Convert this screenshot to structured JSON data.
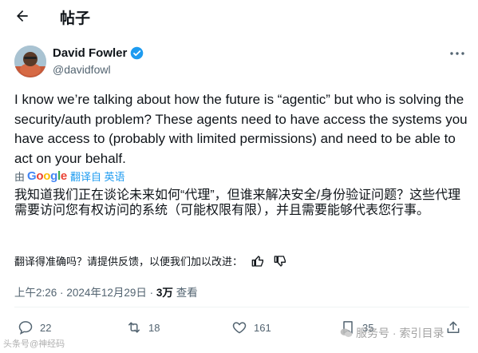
{
  "header": {
    "title": "帖子",
    "back_icon": "arrow-left-icon"
  },
  "author": {
    "name": "David Fowler",
    "handle": "@davidfowl",
    "verified": true
  },
  "tweet": {
    "text": "I know we’re talking about how the future is “agentic” but who is solving the security/auth problem? These agents need to have access the systems you have access to (probably with limited permissions) and need to be able to act on your behalf."
  },
  "translation": {
    "by_prefix": "由",
    "provider": "Google",
    "label": "翻译自 英语",
    "text": "我知道我们正在谈论未来如何“代理”，但谁来解决安全/身份验证问题？这些代理需要访问您有权访问的系统（可能权限有限），并且需要能够代表您行事。",
    "feedback_prompt": "翻译得准确吗？请提供反馈，以便我们加以改进："
  },
  "meta": {
    "time": "上午2:26",
    "date": "2024年12月29日",
    "views_count": "3万",
    "views_label": "查看",
    "sep": "·"
  },
  "actions": {
    "replies": "22",
    "reposts": "18",
    "likes": "161",
    "bookmarks": "35"
  },
  "watermarks": {
    "left": "头条号@神经码",
    "right": "服务号 · 索引目录"
  },
  "colors": {
    "accent": "#1d9bf0",
    "text": "#0f1419",
    "secondary": "#536471"
  }
}
